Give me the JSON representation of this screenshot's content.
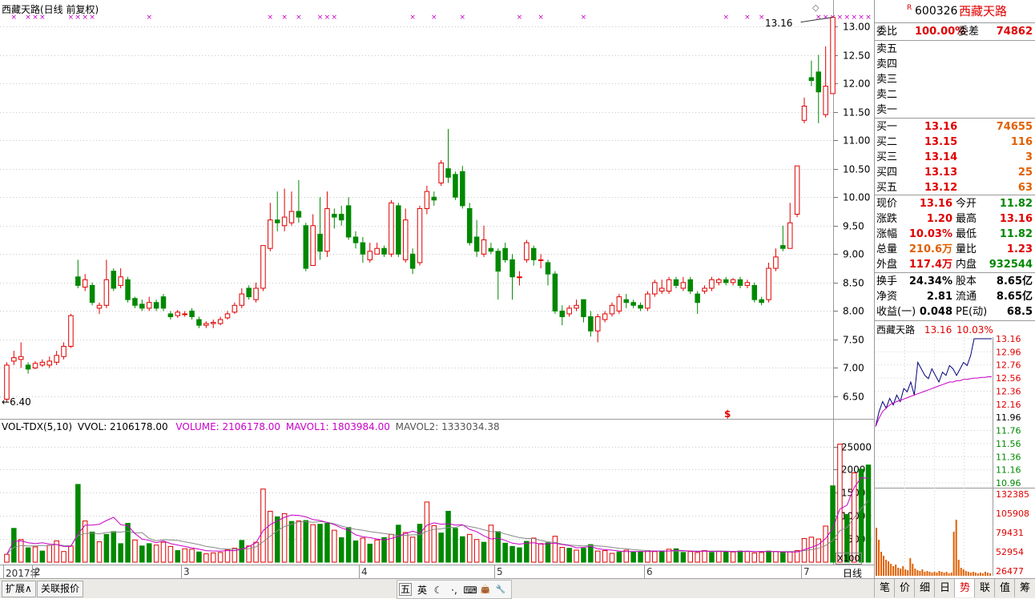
{
  "header": {
    "title": "西藏天路(日线 前复权)",
    "last_price_marker": "13.16",
    "low_marker": "6.40",
    "signal_icon": "$"
  },
  "kline": {
    "y_ticks": [
      "13.00",
      "12.50",
      "12.00",
      "11.50",
      "11.00",
      "10.50",
      "10.00",
      "9.50",
      "9.00",
      "8.50",
      "8.00",
      "7.50",
      "7.00",
      "6.50"
    ],
    "candles": [
      [
        6.45,
        7.05,
        6.4,
        7.1
      ],
      [
        7.12,
        7.18,
        7.05,
        7.3
      ],
      [
        7.15,
        7.2,
        7.0,
        7.45
      ],
      [
        7.05,
        6.98,
        6.9,
        7.1
      ],
      [
        7.0,
        7.08,
        6.98,
        7.12
      ],
      [
        7.05,
        7.1,
        7.02,
        7.15
      ],
      [
        7.05,
        7.12,
        7.0,
        7.2
      ],
      [
        7.1,
        7.22,
        7.05,
        7.3
      ],
      [
        7.2,
        7.38,
        7.15,
        7.45
      ],
      [
        7.38,
        7.92,
        7.35,
        7.95
      ],
      [
        8.6,
        8.45,
        8.4,
        8.9
      ],
      [
        8.42,
        8.55,
        8.35,
        8.65
      ],
      [
        8.45,
        8.15,
        8.1,
        8.5
      ],
      [
        8.05,
        8.1,
        7.95,
        8.15
      ],
      [
        8.1,
        8.55,
        8.05,
        8.9
      ],
      [
        8.7,
        8.4,
        8.35,
        8.75
      ],
      [
        8.45,
        8.6,
        8.4,
        8.75
      ],
      [
        8.55,
        8.2,
        8.15,
        8.6
      ],
      [
        8.22,
        8.1,
        8.05,
        8.25
      ],
      [
        8.12,
        8.05,
        8.0,
        8.2
      ],
      [
        8.05,
        8.15,
        8.0,
        8.25
      ],
      [
        8.15,
        8.05,
        8.0,
        8.2
      ],
      [
        8.25,
        8.05,
        8.0,
        8.3
      ],
      [
        7.95,
        7.9,
        7.85,
        8.0
      ],
      [
        7.92,
        7.98,
        7.88,
        8.02
      ],
      [
        7.95,
        7.95,
        7.9,
        8.0
      ],
      [
        8.0,
        7.9,
        7.85,
        8.05
      ],
      [
        7.85,
        7.75,
        7.7,
        7.9
      ],
      [
        7.75,
        7.78,
        7.7,
        7.82
      ],
      [
        7.78,
        7.8,
        7.7,
        7.85
      ],
      [
        7.78,
        7.85,
        7.75,
        7.9
      ],
      [
        7.88,
        7.95,
        7.85,
        8.0
      ],
      [
        7.98,
        8.1,
        7.95,
        8.15
      ],
      [
        8.1,
        8.3,
        8.05,
        8.4
      ],
      [
        8.4,
        8.25,
        8.2,
        8.45
      ],
      [
        8.2,
        8.4,
        8.15,
        8.5
      ],
      [
        8.4,
        9.15,
        8.35,
        9.15
      ],
      [
        9.1,
        9.6,
        9.05,
        9.9
      ],
      [
        9.6,
        9.55,
        9.4,
        10.1
      ],
      [
        9.5,
        9.65,
        9.4,
        10.15
      ],
      [
        9.55,
        9.75,
        9.5,
        10.1
      ],
      [
        9.75,
        9.65,
        9.55,
        10.3
      ],
      [
        9.5,
        8.75,
        8.7,
        9.55
      ],
      [
        8.8,
        9.5,
        8.8,
        9.7
      ],
      [
        9.35,
        9.05,
        8.9,
        10.0
      ],
      [
        9.05,
        9.8,
        8.95,
        10.1
      ],
      [
        9.7,
        9.65,
        9.45,
        9.8
      ],
      [
        9.7,
        9.6,
        9.5,
        9.85
      ],
      [
        9.85,
        9.3,
        9.25,
        10.0
      ],
      [
        9.3,
        9.2,
        9.1,
        9.4
      ],
      [
        9.2,
        9.0,
        8.85,
        9.3
      ],
      [
        8.9,
        9.05,
        8.85,
        9.2
      ],
      [
        9.0,
        9.1,
        9.0,
        9.2
      ],
      [
        9.1,
        9.0,
        8.95,
        9.15
      ],
      [
        9.0,
        9.9,
        8.95,
        9.95
      ],
      [
        9.85,
        9.0,
        8.95,
        9.9
      ],
      [
        8.9,
        9.6,
        8.85,
        9.8
      ],
      [
        9.0,
        8.75,
        8.65,
        9.1
      ],
      [
        8.85,
        9.8,
        8.8,
        9.85
      ],
      [
        9.8,
        10.1,
        9.7,
        10.2
      ],
      [
        10.0,
        9.95,
        9.85,
        10.1
      ],
      [
        10.25,
        10.6,
        10.2,
        10.65
      ],
      [
        10.5,
        10.35,
        10.25,
        11.2
      ],
      [
        10.4,
        10.0,
        9.95,
        10.45
      ],
      [
        10.45,
        9.85,
        9.8,
        10.55
      ],
      [
        9.8,
        9.2,
        9.15,
        9.9
      ],
      [
        9.3,
        9.05,
        8.95,
        9.6
      ],
      [
        9.0,
        9.25,
        8.95,
        9.5
      ],
      [
        9.1,
        9.05,
        9.0,
        9.2
      ],
      [
        9.05,
        8.7,
        8.2,
        9.1
      ],
      [
        9.1,
        8.9,
        8.85,
        9.2
      ],
      [
        8.9,
        8.6,
        8.2,
        9.0
      ],
      [
        8.6,
        8.6,
        8.45,
        8.7
      ],
      [
        8.9,
        9.2,
        8.85,
        9.25
      ],
      [
        9.1,
        8.9,
        8.8,
        9.15
      ],
      [
        8.9,
        8.9,
        8.75,
        9.0
      ],
      [
        8.85,
        8.65,
        8.45,
        8.9
      ],
      [
        8.65,
        8.0,
        7.95,
        8.7
      ],
      [
        8.0,
        7.9,
        7.75,
        8.1
      ],
      [
        7.95,
        8.05,
        7.9,
        8.1
      ],
      [
        8.05,
        8.1,
        8.0,
        8.2
      ],
      [
        8.2,
        7.9,
        7.8,
        8.2
      ],
      [
        7.9,
        7.65,
        7.55,
        8.0
      ],
      [
        7.65,
        7.9,
        7.45,
        7.95
      ],
      [
        7.85,
        7.95,
        7.8,
        8.0
      ],
      [
        7.95,
        8.1,
        7.9,
        8.15
      ],
      [
        8.0,
        8.25,
        7.95,
        8.3
      ],
      [
        8.2,
        8.15,
        8.05,
        8.3
      ],
      [
        8.15,
        8.1,
        8.05,
        8.2
      ],
      [
        8.1,
        8.05,
        8.0,
        8.15
      ],
      [
        8.05,
        8.3,
        8.0,
        8.35
      ],
      [
        8.3,
        8.5,
        8.25,
        8.55
      ],
      [
        8.35,
        8.4,
        8.3,
        8.55
      ],
      [
        8.35,
        8.55,
        8.3,
        8.6
      ],
      [
        8.55,
        8.45,
        8.4,
        8.6
      ],
      [
        8.4,
        8.5,
        8.35,
        8.6
      ],
      [
        8.55,
        8.35,
        8.3,
        8.6
      ],
      [
        8.3,
        8.15,
        7.95,
        8.35
      ],
      [
        8.35,
        8.4,
        8.3,
        8.45
      ],
      [
        8.4,
        8.55,
        8.35,
        8.6
      ],
      [
        8.5,
        8.55,
        8.45,
        8.58
      ],
      [
        8.55,
        8.5,
        8.45,
        8.6
      ],
      [
        8.5,
        8.55,
        8.45,
        8.58
      ],
      [
        8.55,
        8.45,
        8.4,
        8.6
      ],
      [
        8.45,
        8.5,
        8.4,
        8.55
      ],
      [
        8.45,
        8.2,
        8.15,
        8.5
      ],
      [
        8.2,
        8.15,
        8.1,
        8.25
      ],
      [
        8.2,
        8.75,
        8.15,
        8.85
      ],
      [
        8.75,
        8.95,
        8.7,
        9.1
      ],
      [
        9.15,
        9.1,
        9.05,
        9.5
      ],
      [
        9.1,
        9.55,
        9.1,
        9.9
      ],
      [
        9.7,
        10.55,
        9.65,
        10.55
      ],
      [
        11.35,
        11.6,
        11.3,
        11.75
      ],
      [
        12.1,
        12.05,
        11.95,
        12.4
      ],
      [
        12.2,
        11.85,
        11.3,
        12.5
      ],
      [
        11.45,
        11.95,
        11.4,
        12.65
      ],
      [
        11.82,
        13.16,
        11.82,
        13.16
      ]
    ]
  },
  "kline_markers": {
    "x_positions": [
      1,
      3,
      4,
      5,
      9,
      10,
      11,
      12,
      20,
      37,
      39,
      41,
      44,
      45,
      46,
      57,
      60,
      64,
      72,
      75,
      81,
      101,
      104,
      106,
      114,
      115,
      116,
      117,
      118,
      119,
      120,
      121
    ]
  },
  "volume": {
    "legend": {
      "label": "VOL-TDX(5,10)",
      "vvol": "VVOL: 2106178.00",
      "volume": "VOLUME: 2106178.00",
      "mavol1": "MAVOL1: 1803984.00",
      "mavol2": "MAVOL2: 1333034.38"
    },
    "y_ticks": [
      "25000",
      "20000",
      "15000",
      "10000",
      "5000"
    ],
    "multiplier": "X100",
    "bars": [
      1700,
      7300,
      4900,
      3100,
      3300,
      2400,
      3600,
      4600,
      2300,
      3500,
      16800,
      8900,
      6500,
      4400,
      6000,
      6600,
      4000,
      8400,
      4800,
      3500,
      4000,
      3700,
      4300,
      3400,
      2500,
      2900,
      2800,
      2200,
      1800,
      2000,
      2100,
      2700,
      3000,
      4700,
      3500,
      4300,
      15800,
      11000,
      9800,
      10500,
      8800,
      8900,
      9000,
      8100,
      8200,
      8400,
      6900,
      5300,
      7500,
      4600,
      5200,
      3900,
      4800,
      5300,
      6000,
      8000,
      6400,
      5400,
      8200,
      13000,
      7900,
      6300,
      11000,
      7300,
      5500,
      6000,
      4900,
      4300,
      8000,
      6600,
      4100,
      3400,
      3100,
      4500,
      5200,
      4000,
      4200,
      5600,
      3200,
      3000,
      2600,
      3000,
      3800,
      2400,
      2500,
      1900,
      2200,
      2600,
      2200,
      2300,
      2500,
      2300,
      2400,
      2800,
      2900,
      2100,
      2300,
      2100,
      2500,
      2100,
      2400,
      2200,
      2200,
      2400,
      2300,
      2000,
      2100,
      2400,
      2300,
      2100,
      2200,
      2500,
      5100,
      5400,
      5000,
      7800,
      16500,
      25500,
      10300,
      19300,
      20100,
      21000
    ],
    "bar_colors": "rgrgrgrrrrgrgrggggrggrrrgrrgrrrrrgrrrrgrgrgrggrgggrgrgrgrrgrrggggrrgrgggggrrgrrgrggrrrgrggrrgrggrrrgrgrgrrrgrgrrrrrrgrgr",
    "mavol1": [
      1700,
      4500,
      4600,
      4200,
      4000,
      4200,
      3900,
      3800,
      3400,
      3400,
      6100,
      8000,
      8000,
      8200,
      9000,
      9700,
      8100,
      7900,
      6200,
      5000,
      4700,
      4200,
      4600,
      4000,
      3700,
      3400,
      3100,
      2800,
      2500,
      2400,
      2400,
      2500,
      2500,
      2800,
      3400,
      4200,
      6800,
      8100,
      8900,
      9700,
      10200,
      10100,
      9800,
      9200,
      9000,
      8600,
      8100,
      7400,
      6900,
      5900,
      5500,
      5300,
      5000,
      4800,
      5100,
      5600,
      6200,
      6700,
      6200,
      8000,
      8500,
      8200,
      8300,
      8000,
      8100,
      7100,
      6600,
      5700,
      5000,
      5200,
      4700,
      4100,
      3900,
      4100,
      4200,
      3900,
      4000,
      4100,
      3800,
      3600,
      3100,
      3200,
      3400,
      2900,
      2700,
      2600,
      2400,
      2300,
      2300,
      2300,
      2300,
      2400,
      2400,
      2400,
      2600,
      2500,
      2400,
      2300,
      2400,
      2300,
      2300,
      2300,
      2300,
      2300,
      2400,
      2300,
      2300,
      2300,
      2300,
      2200,
      2200,
      2200,
      2700,
      3200,
      3800,
      5100,
      7300,
      11500,
      12300,
      16100,
      18300,
      18100
    ],
    "mavol2": [
      1700,
      3200,
      3600,
      3500,
      3500,
      3600,
      3600,
      3800,
      3600,
      3500,
      5800,
      6200,
      6300,
      6100,
      6400,
      6500,
      6500,
      6700,
      6300,
      6400,
      5100,
      4600,
      4900,
      4800,
      4700,
      4400,
      4100,
      3800,
      3400,
      3200,
      2900,
      2800,
      2800,
      2800,
      2900,
      3300,
      4400,
      5600,
      6800,
      7700,
      8200,
      8700,
      8800,
      8600,
      8800,
      8600,
      8300,
      7800,
      7400,
      7100,
      6900,
      6600,
      6400,
      6200,
      6000,
      5700,
      5800,
      5900,
      5900,
      6700,
      7100,
      7200,
      7500,
      7500,
      8000,
      7700,
      7400,
      7000,
      6600,
      6600,
      6100,
      5700,
      5300,
      5100,
      5100,
      4700,
      4400,
      4300,
      3900,
      3700,
      3600,
      3500,
      3600,
      3500,
      3400,
      3200,
      3000,
      2900,
      2700,
      2600,
      2500,
      2400,
      2400,
      2400,
      2400,
      2400,
      2400,
      2400,
      2400,
      2400,
      2400,
      2400,
      2300,
      2300,
      2300,
      2300,
      2300,
      2300,
      2300,
      2300,
      2300,
      2300,
      2500,
      2700,
      3000,
      3600,
      4700,
      6800,
      7500,
      9600,
      11600,
      13300
    ]
  },
  "x_axis": {
    "labels": [
      {
        "text": "2017年",
        "i": 0
      },
      {
        "text": "2",
        "i": 4
      },
      {
        "text": "3",
        "i": 25
      },
      {
        "text": "4",
        "i": 50
      },
      {
        "text": "5",
        "i": 69
      },
      {
        "text": "6",
        "i": 90
      },
      {
        "text": "7",
        "i": 112
      }
    ],
    "period": "日线"
  },
  "quote": {
    "code": "600326",
    "name": "西藏天路",
    "flag": "R",
    "weibi_label": "委比",
    "weibi": "100.00%",
    "weicha_label": "委差",
    "weicha": "74862",
    "sell": [
      {
        "label": "卖五"
      },
      {
        "label": "卖四"
      },
      {
        "label": "卖三"
      },
      {
        "label": "卖二"
      },
      {
        "label": "卖一"
      }
    ],
    "buy": [
      {
        "label": "买一",
        "price": "13.16",
        "vol": "74655"
      },
      {
        "label": "买二",
        "price": "13.15",
        "vol": "116"
      },
      {
        "label": "买三",
        "price": "13.14",
        "vol": "3"
      },
      {
        "label": "买四",
        "price": "13.13",
        "vol": "25"
      },
      {
        "label": "买五",
        "price": "13.12",
        "vol": "63"
      }
    ],
    "stats": [
      {
        "l1": "现价",
        "v1": "13.16",
        "c1": "red",
        "l2": "今开",
        "v2": "11.82",
        "c2": "green"
      },
      {
        "l1": "涨跌",
        "v1": "1.20",
        "c1": "red",
        "l2": "最高",
        "v2": "13.16",
        "c2": "red"
      },
      {
        "l1": "涨幅",
        "v1": "10.03%",
        "c1": "red",
        "l2": "最低",
        "v2": "11.82",
        "c2": "green"
      },
      {
        "l1": "总量",
        "v1": "210.6万",
        "c1": "orange",
        "l2": "量比",
        "v2": "1.23",
        "c2": "red"
      },
      {
        "l1": "外盘",
        "v1": "117.4万",
        "c1": "red",
        "l2": "内盘",
        "v2": "932544",
        "c2": "green"
      }
    ],
    "stats2": [
      {
        "l1": "换手",
        "v1": "24.34%",
        "l2": "股本",
        "v2": "8.65亿"
      },
      {
        "l1": "净资",
        "v1": "2.81",
        "l2": "流通",
        "v2": "8.65亿"
      },
      {
        "l1": "收益(一)",
        "v1": "0.048",
        "l2": "PE(动)",
        "v2": "68.5"
      }
    ]
  },
  "intraday": {
    "name": "西藏天路",
    "price": "13.16",
    "pct": "10.03%",
    "price_ticks": [
      "13.16",
      "12.96",
      "12.76",
      "12.56",
      "12.36",
      "12.16",
      "11.96",
      "11.76",
      "11.56",
      "11.36",
      "11.16",
      "10.96"
    ],
    "vol_ticks": [
      "132385",
      "105908",
      "79431",
      "52954",
      "26477"
    ]
  },
  "bottom": {
    "left_tabs": [
      "扩展∧",
      "关联报价"
    ],
    "right_tabs": [
      "笔",
      "价",
      "细",
      "日",
      "势",
      "联",
      "值",
      "筹"
    ],
    "active_right_tab": 4,
    "ime_icons": [
      "五",
      "英",
      "☾",
      "·,",
      "⌨",
      "👜",
      "🔧"
    ]
  },
  "colors": {
    "up": "#e00000",
    "down": "#008800",
    "accent": "#c800c8"
  }
}
